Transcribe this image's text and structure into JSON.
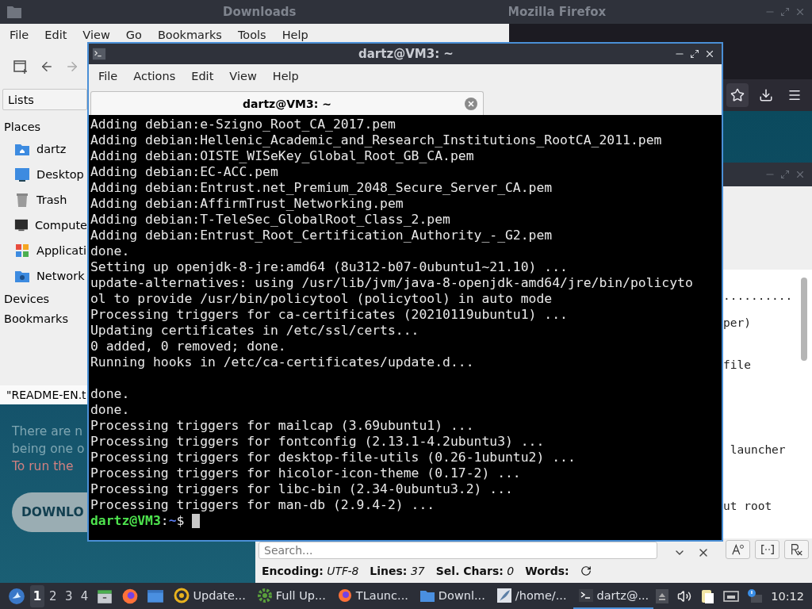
{
  "firefox": {
    "title": "Mozilla Firefox",
    "page": {
      "lines": [
        {
          "text": "There are n",
          "kind": "muted"
        },
        {
          "text": "being one o",
          "kind": "muted"
        },
        {
          "text": "To run the",
          "kind": "warning"
        }
      ],
      "button": "DOWNLO"
    }
  },
  "editor": {
    "lines": [
      "..........",
      "per)",
      "file",
      " launcher",
      "ut root"
    ],
    "search": {
      "placeholder": "Search..."
    },
    "status": [
      {
        "label": "Encoding:",
        "value": "UTF-8"
      },
      {
        "label": "Lines:",
        "value": "37"
      },
      {
        "label": "Sel. Chars:",
        "value": "0"
      },
      {
        "label": "Words:"
      }
    ]
  },
  "file_manager": {
    "title": "Downloads",
    "menu": [
      "File",
      "Edit",
      "View",
      "Go",
      "Bookmarks",
      "Tools",
      "Help"
    ],
    "side_panel": {
      "mode": "Lists",
      "sections": [
        {
          "label": "Places",
          "items": [
            {
              "label": "dartz",
              "kind": "home"
            },
            {
              "label": "Desktop",
              "kind": "desktop"
            },
            {
              "label": "Trash",
              "kind": "trash"
            },
            {
              "label": "Compute",
              "kind": "computer"
            },
            {
              "label": "Applicati",
              "kind": "apps"
            },
            {
              "label": "Network",
              "kind": "network"
            }
          ]
        },
        {
          "label": "Devices"
        },
        {
          "label": "Bookmarks"
        }
      ]
    },
    "status": "\"README-EN.t"
  },
  "terminal": {
    "title": "dartz@VM3: ~",
    "menu": [
      "File",
      "Actions",
      "Edit",
      "View",
      "Help"
    ],
    "tabs": [
      {
        "label": "dartz@VM3: ~",
        "selected": true
      }
    ],
    "output": [
      [
        "Adding debian:e-Szigno_Root_CA_2017.pem",
        "Adding debian:Hellenic_Academic_and_Research_Institutions_RootCA_2011.pem",
        "Adding debian:OISTE_WISeKey_Global_Root_GB_CA.pem",
        "Adding debian:EC-ACC.pem",
        "Adding debian:Entrust.net_Premium_2048_Secure_Server_CA.pem",
        "Adding debian:AffirmTrust_Networking.pem",
        "Adding debian:T-TeleSec_GlobalRoot_Class_2.pem",
        "Adding debian:Entrust_Root_Certification_Authority_-_G2.pem",
        "done.",
        "Setting up openjdk-8-jre:amd64 (8u312-b07-0ubuntu1~21.10) ...",
        "update-alternatives: using /usr/lib/jvm/java-8-openjdk-amd64/jre/bin/policyto",
        "ol to provide /usr/bin/policytool (policytool) in auto mode",
        "Processing triggers for ca-certificates (20210119ubuntu1) ...",
        "Updating certificates in /etc/ssl/certs...",
        "0 added, 0 removed; done.",
        "Running hooks in /etc/ca-certificates/update.d..."
      ],
      [
        "done.",
        "done.",
        "Processing triggers for mailcap (3.69ubuntu1) ...",
        "Processing triggers for fontconfig (2.13.1-4.2ubuntu3) ...",
        "Processing triggers for desktop-file-utils (0.26-1ubuntu2) ...",
        "Processing triggers for hicolor-icon-theme (0.17-2) ...",
        "Processing triggers for libc-bin (2.34-0ubuntu3.2) ...",
        "Processing triggers for man-db (2.9.4-2) ..."
      ]
    ],
    "prompt": {
      "user": "dartz@VM3",
      "separator": ":",
      "path": "~",
      "symbol": "$"
    }
  },
  "taskbar": {
    "workspaces": [
      {
        "label": "1",
        "selected": true
      },
      {
        "label": "2",
        "selected": false
      },
      {
        "label": "3",
        "selected": false
      },
      {
        "label": "4",
        "selected": false
      }
    ],
    "tasks": [
      {
        "label": "Update...",
        "kind": "updater",
        "selected": false
      },
      {
        "label": "Full Up...",
        "kind": "gear",
        "selected": false
      },
      {
        "label": "TLaunc...",
        "kind": "firefox",
        "selected": false
      },
      {
        "label": "Downl...",
        "kind": "folder",
        "selected": false
      },
      {
        "label": "/home/...",
        "kind": "feather",
        "selected": false
      },
      {
        "label": "dartz@...",
        "kind": "terminal",
        "selected": true
      }
    ],
    "clock": "10:12"
  }
}
